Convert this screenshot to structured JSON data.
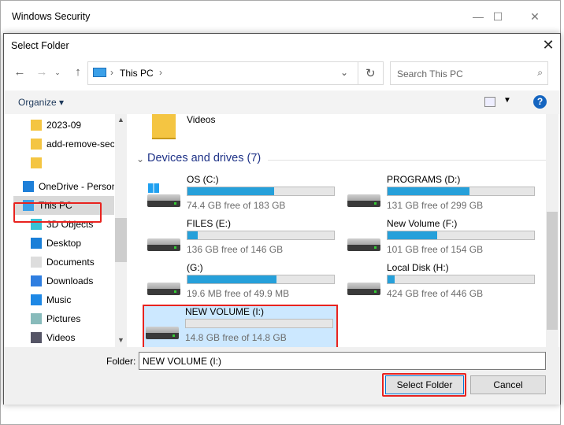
{
  "background_window": {
    "title": "Windows Security"
  },
  "dialog": {
    "title": "Select Folder"
  },
  "address": {
    "location": "This PC",
    "search_placeholder": "Search This PC"
  },
  "toolbar": {
    "organize": "Organize"
  },
  "nav": {
    "items": [
      {
        "label": "2023-09",
        "icon": "folder-icon"
      },
      {
        "label": "add-remove-sec",
        "icon": "folder-icon"
      },
      {
        "label": "",
        "icon": "folder-icon"
      },
      {
        "label": "OneDrive - Personal",
        "icon": "onedrive-icon"
      },
      {
        "label": "This PC",
        "icon": "computer-icon",
        "selected": true
      },
      {
        "label": "3D Objects",
        "icon": "3d-objects-icon"
      },
      {
        "label": "Desktop",
        "icon": "desktop-icon"
      },
      {
        "label": "Documents",
        "icon": "documents-icon"
      },
      {
        "label": "Downloads",
        "icon": "downloads-icon"
      },
      {
        "label": "Music",
        "icon": "music-icon"
      },
      {
        "label": "Pictures",
        "icon": "pictures-icon"
      },
      {
        "label": "Videos",
        "icon": "videos-icon"
      }
    ]
  },
  "content": {
    "videos_label": "Videos",
    "section_title": "Devices and drives (7)",
    "drives": [
      {
        "name": "OS (C:)",
        "free": "74.4 GB free of 183 GB",
        "used_fraction": 0.59,
        "windows": true
      },
      {
        "name": "PROGRAMS (D:)",
        "free": "131 GB free of 299 GB",
        "used_fraction": 0.56
      },
      {
        "name": "FILES (E:)",
        "free": "136 GB free of 146 GB",
        "used_fraction": 0.07
      },
      {
        "name": "New Volume (F:)",
        "free": "101 GB free of 154 GB",
        "used_fraction": 0.34
      },
      {
        "name": "(G:)",
        "free": "19.6 MB free of 49.9 MB",
        "used_fraction": 0.61
      },
      {
        "name": "Local Disk (H:)",
        "free": "424 GB free of 446 GB",
        "used_fraction": 0.05
      },
      {
        "name": "NEW VOLUME (I:)",
        "free": "14.8 GB free of 14.8 GB",
        "used_fraction": 0.0,
        "selected": true
      }
    ]
  },
  "footer": {
    "folder_label": "Folder:",
    "folder_value": "NEW VOLUME (I:)",
    "select_button": "Select Folder",
    "cancel_button": "Cancel"
  },
  "colors": {
    "accent": "#26a0da",
    "highlight": "#e8231f",
    "selection": "#cce8ff"
  }
}
